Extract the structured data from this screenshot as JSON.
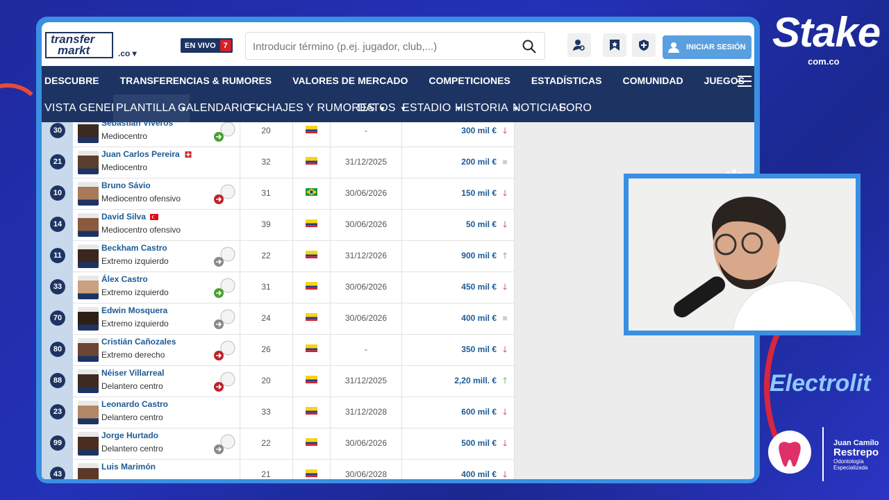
{
  "site": {
    "logo_line1": "transfer",
    "logo_line2": "markt",
    "tld": ".co ▾"
  },
  "live": {
    "label": "EN VIVO",
    "count": "7"
  },
  "search": {
    "placeholder": "Introducir término (p.ej. jugador, club,...)"
  },
  "login": {
    "label": "INICIAR SESIÓN"
  },
  "main_nav": [
    "DESCUBRE",
    "TRANSFERENCIAS & RUMORES",
    "VALORES DE MERCADO",
    "COMPETICIONES",
    "ESTADÍSTICAS",
    "COMUNIDAD",
    "JUEGOS"
  ],
  "sub_nav": [
    {
      "label": "VISTA GENERAL",
      "caret": ""
    },
    {
      "label": "PLANTILLA",
      "caret": "▼",
      "active": true
    },
    {
      "label": "CALENDARIO",
      "caret": "▼"
    },
    {
      "label": "FICHAJES Y RUMORES",
      "caret": "▼"
    },
    {
      "label": "DATOS",
      "caret": "▼"
    },
    {
      "label": "ESTADIO",
      "caret": "▼"
    },
    {
      "label": "HISTORIA",
      "caret": "▼"
    },
    {
      "label": "NOTICIAS",
      "caret": ""
    },
    {
      "label": "FORO",
      "caret": ""
    }
  ],
  "players": [
    {
      "number": "30",
      "name": "Sebastián Viveros",
      "position": "Mediocentro",
      "age": "20",
      "contract": "-",
      "value": "300 mil €",
      "trend": "down",
      "trend_glyph": "🡓",
      "club": "loan-in"
    },
    {
      "number": "21",
      "name": "Juan Carlos Pereira",
      "position": "Mediocentro",
      "age": "32",
      "contract": "31/12/2025",
      "value": "200 mil €",
      "trend": "same",
      "trend_glyph": "■",
      "club": "",
      "flag2": "injury"
    },
    {
      "number": "10",
      "name": "Bruno Sávio",
      "position": "Mediocentro ofensivo",
      "age": "31",
      "contract": "30/06/2026",
      "value": "150 mil €",
      "trend": "down",
      "trend_glyph": "🡓",
      "club": "loan-out",
      "nat": "brazil"
    },
    {
      "number": "14",
      "name": "David Silva",
      "position": "Mediocentro ofensivo",
      "age": "39",
      "contract": "30/06/2026",
      "value": "50 mil €",
      "trend": "down",
      "trend_glyph": "🡓",
      "club": "",
      "flag2": "turkey"
    },
    {
      "number": "11",
      "name": "Beckham Castro",
      "position": "Extremo izquierdo",
      "age": "22",
      "contract": "31/12/2026",
      "value": "900 mil €",
      "trend": "up",
      "trend_glyph": "🡑",
      "club": "grey"
    },
    {
      "number": "33",
      "name": "Álex Castro",
      "position": "Extremo izquierdo",
      "age": "31",
      "contract": "30/06/2026",
      "value": "450 mil €",
      "trend": "down",
      "trend_glyph": "🡓",
      "club": "loan-in"
    },
    {
      "number": "70",
      "name": "Edwin Mosquera",
      "position": "Extremo izquierdo",
      "age": "24",
      "contract": "30/06/2026",
      "value": "400 mil €",
      "trend": "same",
      "trend_glyph": "■",
      "club": "grey"
    },
    {
      "number": "80",
      "name": "Cristián Cañozales",
      "position": "Extremo derecho",
      "age": "26",
      "contract": "-",
      "value": "350 mil €",
      "trend": "down",
      "trend_glyph": "🡓",
      "club": "loan-out"
    },
    {
      "number": "88",
      "name": "Néiser Villarreal",
      "position": "Delantero centro",
      "age": "20",
      "contract": "31/12/2025",
      "value": "2,20 mill. €",
      "trend": "up",
      "trend_glyph": "🡑",
      "club": "loan-out"
    },
    {
      "number": "23",
      "name": "Leonardo Castro",
      "position": "Delantero centro",
      "age": "33",
      "contract": "31/12/2028",
      "value": "600 mil €",
      "trend": "down",
      "trend_glyph": "🡓",
      "club": ""
    },
    {
      "number": "99",
      "name": "Jorge Hurtado",
      "position": "Delantero centro",
      "age": "22",
      "contract": "30/06/2026",
      "value": "500 mil €",
      "trend": "down",
      "trend_glyph": "🡓",
      "club": "grey"
    },
    {
      "number": "43",
      "name": "Luis Marimón",
      "position": "",
      "age": "21",
      "contract": "30/06/2028",
      "value": "400 mil €",
      "trend": "down",
      "trend_glyph": "🡓",
      "club": ""
    }
  ],
  "overlay": {
    "sponsor1": "Stake",
    "sponsor1_sub": "com.co",
    "sponsor2": "Electrolit",
    "sponsor3_line1": "Juan Camilo",
    "sponsor3_line2": "Restrepo",
    "sponsor3_line3": "Odontología Especializada"
  },
  "colors": {
    "nav": "#1d3463",
    "accent": "#3a8fe3",
    "down": "#c0202a",
    "up": "#4aa02c",
    "same": "#cccccc"
  }
}
